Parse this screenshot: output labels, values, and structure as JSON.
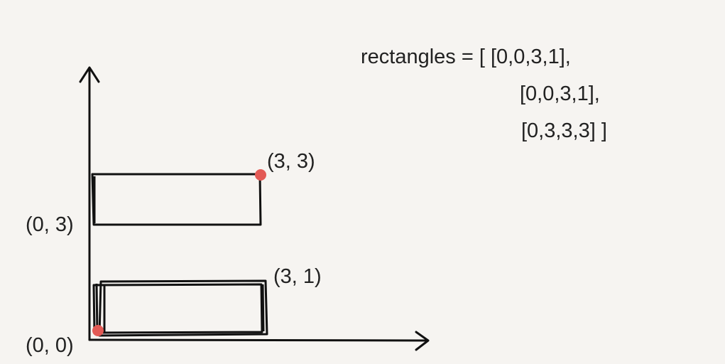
{
  "rectangles_text": {
    "line1": "rectangles = [ [0,0,3,1],",
    "line2": "[0,0,3,1],",
    "line3": "[0,3,3,3] ]"
  },
  "point_labels": {
    "p33": "(3, 3)",
    "p03": "(0, 3)",
    "p31": "(3, 1)",
    "p00": "(0, 0)"
  },
  "colors": {
    "background": "#f6f4f1",
    "stroke": "#111111",
    "point": "#e35a55"
  }
}
